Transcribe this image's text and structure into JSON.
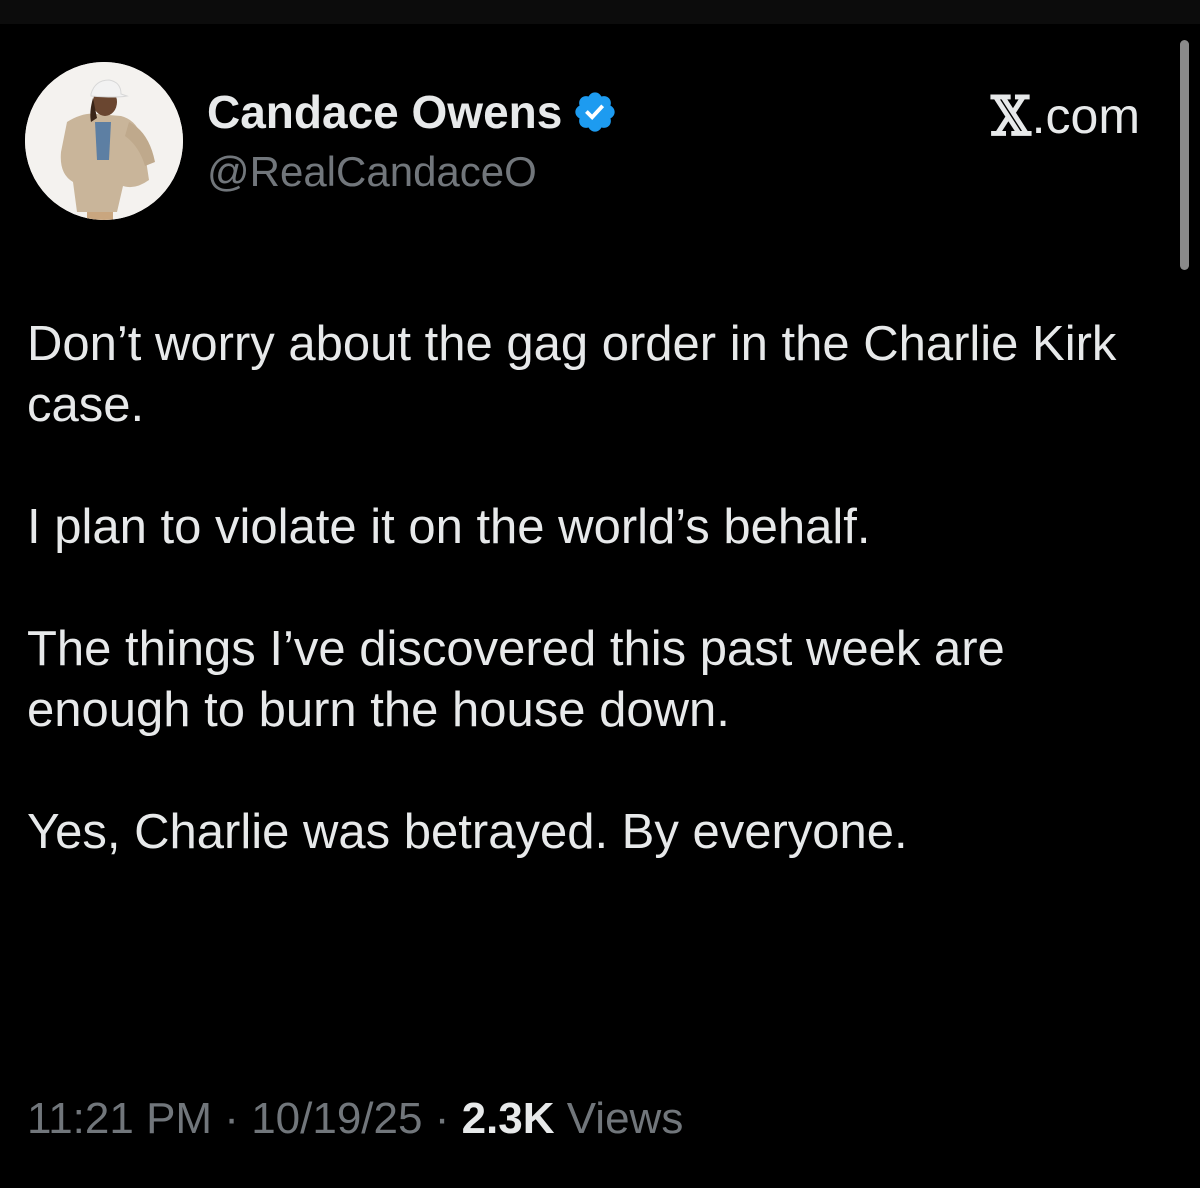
{
  "author": {
    "display_name": "Candace Owens",
    "handle": "@RealCandaceO",
    "verified": true,
    "avatar_icon": "avatar-photo"
  },
  "brand": {
    "name": ".com",
    "logo_icon": "x-logo-icon"
  },
  "tweet": {
    "paragraphs": [
      "Don’t worry about the gag order in the Charlie Kirk case.",
      "I plan to violate it on the world’s behalf.",
      "The things I’ve discovered this past week are enough to burn the house down.",
      "Yes, Charlie was betrayed. By everyone."
    ]
  },
  "meta": {
    "time": "11:21 PM",
    "separator": " · ",
    "date": "10/19/25",
    "views_count": "2.3K",
    "views_label": " Views"
  },
  "colors": {
    "background": "#000000",
    "primary_text": "#e7e9ea",
    "secondary_text": "#71767b",
    "verified_blue": "#1d9bf0"
  }
}
